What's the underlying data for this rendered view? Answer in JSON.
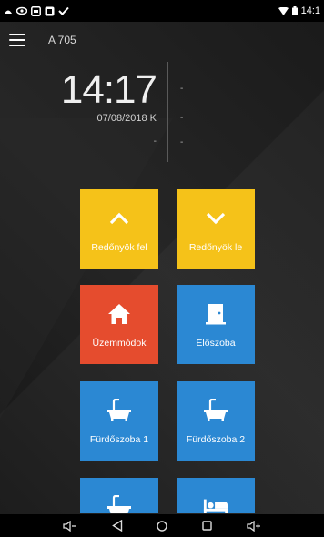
{
  "status_bar": {
    "time": "14:1",
    "icons": [
      "notification-dot-icon",
      "eye-icon",
      "gallery-icon",
      "app-icon",
      "check-icon",
      "wifi-icon",
      "battery-icon"
    ]
  },
  "header": {
    "room_title": "A 705"
  },
  "clock": {
    "time": "14:17",
    "date": "07/08/2018 K",
    "placeholder_left": "-",
    "right_values": [
      "-",
      "-",
      "-"
    ]
  },
  "tiles": [
    {
      "label": "Redőnyök fel",
      "icon": "chevron-up-icon",
      "color": "#f5c219"
    },
    {
      "label": "Redőnyök le",
      "icon": "chevron-down-icon",
      "color": "#f5c219"
    },
    {
      "label": "Üzemmódok",
      "icon": "home-icon",
      "color": "#e54c2e"
    },
    {
      "label": "Előszoba",
      "icon": "door-icon",
      "color": "#2b88d3"
    },
    {
      "label": "Fürdőszoba 1",
      "icon": "bathtub-icon",
      "color": "#2b88d3"
    },
    {
      "label": "Fürdőszoba 2",
      "icon": "bathtub-icon",
      "color": "#2b88d3"
    },
    {
      "label": "",
      "icon": "bathtub-icon",
      "color": "#2b88d3"
    },
    {
      "label": "",
      "icon": "bed-icon",
      "color": "#2b88d3"
    }
  ],
  "nav_bar": {
    "icons": [
      "volume-down-icon",
      "back-icon",
      "home-circle-icon",
      "recents-icon",
      "volume-up-icon"
    ]
  }
}
